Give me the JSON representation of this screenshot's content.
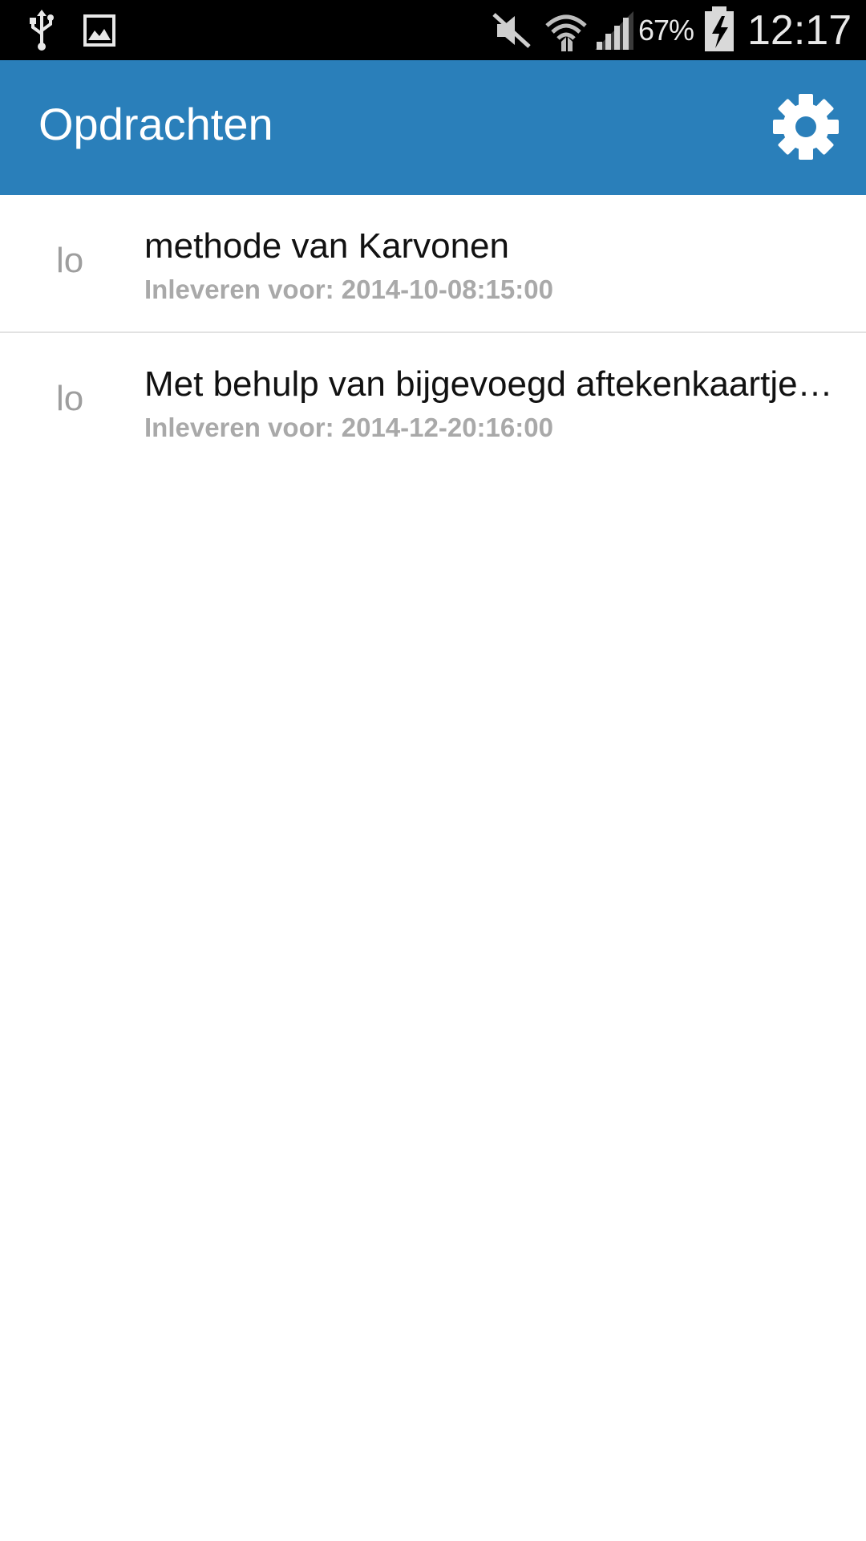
{
  "status_bar": {
    "battery_percent": "67%",
    "time": "12:17",
    "icons": [
      "usb-icon",
      "image-icon",
      "mute-icon",
      "wifi-icon",
      "signal-icon",
      "battery-charging-icon"
    ]
  },
  "action_bar": {
    "title": "Opdrachten",
    "settings_icon": "gear-icon",
    "background": "#2a7fba"
  },
  "assignments": [
    {
      "icon_text": "lo",
      "title": "methode van Karvonen",
      "due": "Inleveren voor: 2014-10-08:15:00"
    },
    {
      "icon_text": "lo",
      "title": "Met behulp van bijgevoegd aftekenkaartje…",
      "due": "Inleveren voor: 2014-12-20:16:00"
    }
  ]
}
